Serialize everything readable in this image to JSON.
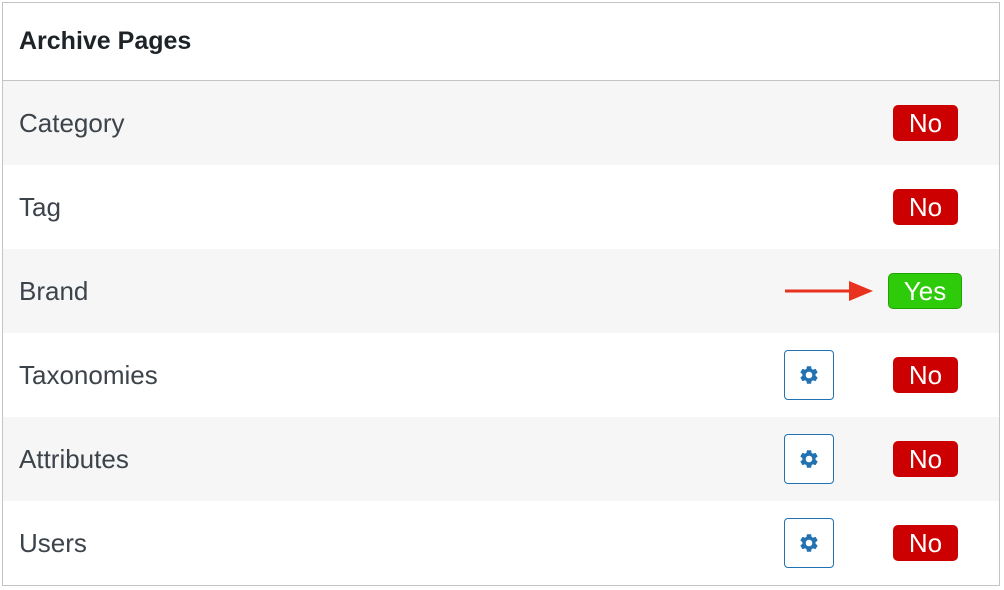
{
  "panel": {
    "title": "Archive Pages"
  },
  "rows": [
    {
      "label": "Category",
      "status": "No",
      "has_settings": false
    },
    {
      "label": "Tag",
      "status": "No",
      "has_settings": false
    },
    {
      "label": "Brand",
      "status": "Yes",
      "has_settings": false,
      "highlighted_with_arrow": true
    },
    {
      "label": "Taxonomies",
      "status": "No",
      "has_settings": true
    },
    {
      "label": "Attributes",
      "status": "No",
      "has_settings": true
    },
    {
      "label": "Users",
      "status": "No",
      "has_settings": true
    }
  ],
  "icons": {
    "settings": "gear-icon",
    "pointer": "arrow-right-icon"
  },
  "colors": {
    "no_badge": "#cc0000",
    "yes_badge": "#2ecb0a",
    "gear_accent": "#2271b1",
    "arrow": "#e8321e"
  }
}
